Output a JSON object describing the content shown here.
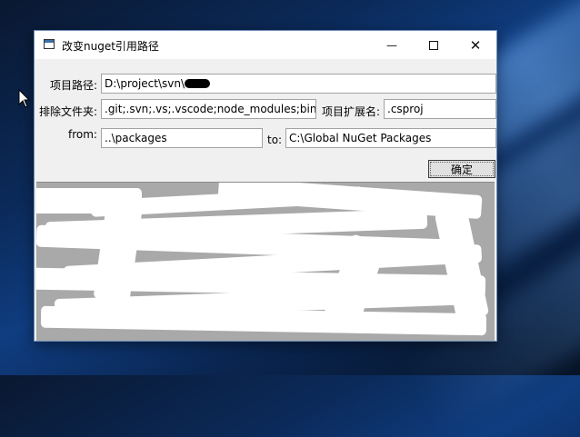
{
  "window": {
    "title": "改变nuget引用路径",
    "controls": {
      "minimize": "—",
      "close": "✕"
    }
  },
  "form": {
    "project_path_label": "项目路径:",
    "project_path_value": "D:\\project\\svn\\",
    "exclude_folders_label": "排除文件夹:",
    "exclude_folders_value": ".git;.svn;.vs;.vscode;node_modules;bin;obj",
    "project_ext_label": "项目扩展名:",
    "project_ext_value": ".csproj",
    "from_label": "from:",
    "from_value": "..\\packages",
    "to_label": "to:",
    "to_value": "C:\\Global NuGet Packages",
    "ok_button": "确定"
  }
}
